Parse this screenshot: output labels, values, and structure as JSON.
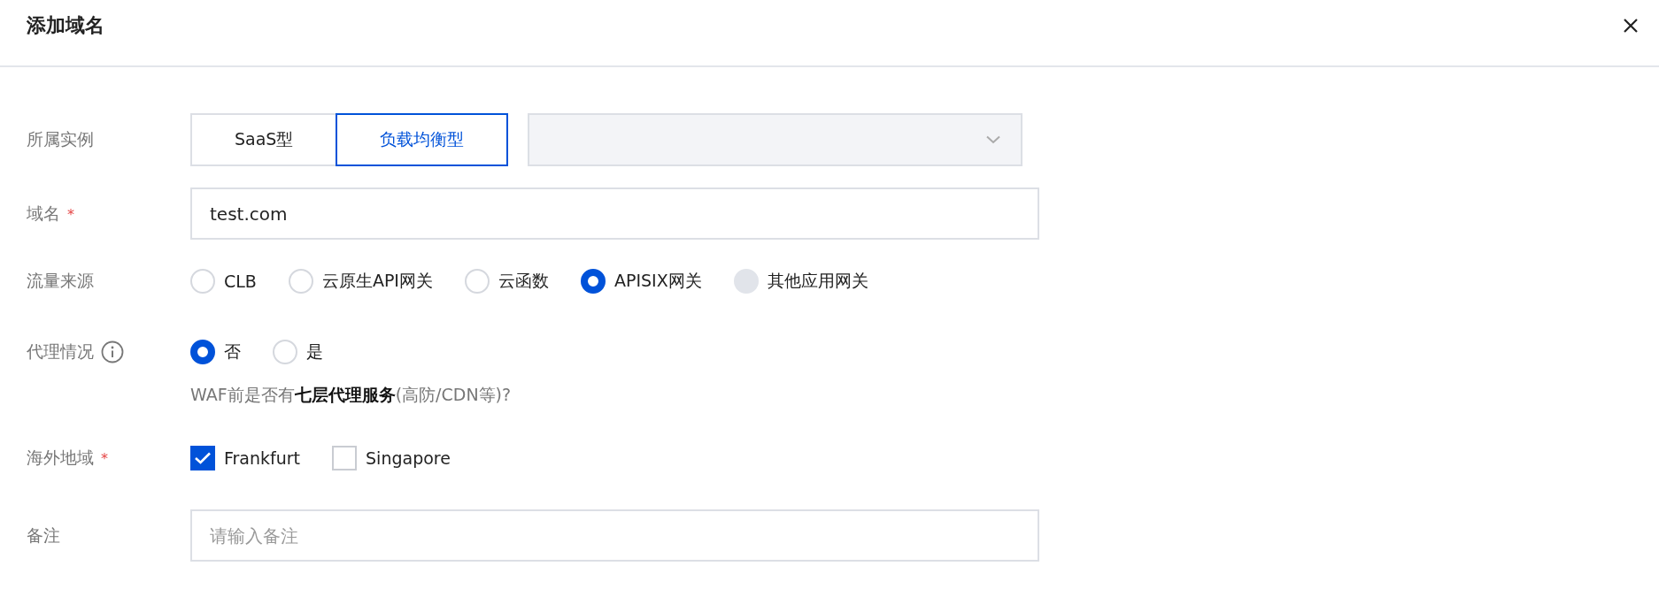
{
  "dialog": {
    "title": "添加域名"
  },
  "fields": [
    {
      "kind": "instance",
      "label": "所属实例",
      "segments": [
        {
          "label": "SaaS型",
          "selected": false
        },
        {
          "label": "负载均衡型",
          "selected": true
        }
      ],
      "select": {
        "disabled": true
      }
    },
    {
      "kind": "text",
      "label": "域名",
      "required_mark": "*",
      "value": "test.com"
    },
    {
      "kind": "radio",
      "label": "流量来源",
      "options": [
        {
          "label": "CLB",
          "selected": false,
          "disabled": false
        },
        {
          "label": "云原生API网关",
          "selected": false,
          "disabled": false
        },
        {
          "label": "云函数",
          "selected": false,
          "disabled": false
        },
        {
          "label": "APISIX网关",
          "selected": true,
          "disabled": false
        },
        {
          "label": "其他应用网关",
          "selected": false,
          "disabled": true
        }
      ]
    },
    {
      "kind": "radio",
      "label": "代理情况",
      "info": true,
      "options": [
        {
          "label": "否",
          "selected": true,
          "disabled": false
        },
        {
          "label": "是",
          "selected": false,
          "disabled": false
        }
      ],
      "hint": "WAF前是否有**七层代理服务**(高防/CDN等)?"
    },
    {
      "kind": "checkbox",
      "label": "海外地域",
      "required_mark": "*",
      "options": [
        {
          "label": "Frankfurt",
          "checked": true
        },
        {
          "label": "Singapore",
          "checked": false
        }
      ]
    },
    {
      "kind": "text",
      "label": "备注",
      "placeholder": "请输入备注"
    }
  ]
}
